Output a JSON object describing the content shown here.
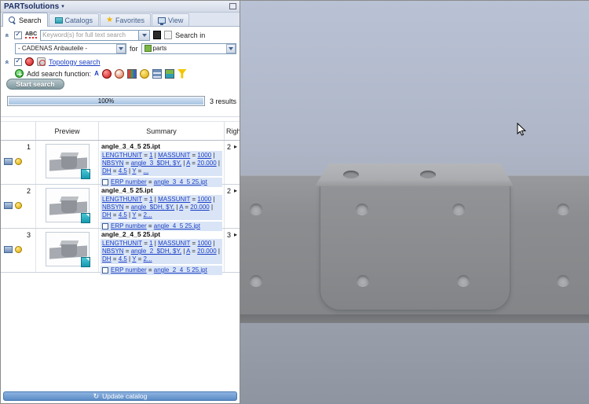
{
  "window": {
    "title": "PARTsolutions"
  },
  "icons": {
    "caret": "▾",
    "check": "✓",
    "star": "★",
    "refresh": "↻",
    "chevrons": "«",
    "expand": "▸",
    "fx_text": "A"
  },
  "tabs": {
    "search": "Search",
    "catalogs": "Catalogs",
    "favorites": "Favorites",
    "view": "View"
  },
  "search": {
    "abc": "ABC",
    "keyword_placeholder": "Keyword(s) for full text search",
    "search_in": "Search in",
    "catalog_value": "- CADENAS Anbauteile -",
    "for_label": "for",
    "scope_value": "parts",
    "topology_link": "Topology search",
    "add_function": "Add search function:",
    "start_button": "Start search"
  },
  "progress": {
    "percent": "100%",
    "results": "3 results"
  },
  "results": {
    "headers": {
      "preview": "Preview",
      "summary": "Summary",
      "right": "Right"
    },
    "rows": [
      {
        "index": "1",
        "title": "angle_3_4_5 25.ipt",
        "params": "LENGTHUNIT = 1 | MASSUNIT = 1000 | NBSYN = angle_3_$DH, $Y, | A = 20.000 | DH = 4.5 | Y = ...",
        "erp": "ERP number = angle_3_4_5 25.ipt",
        "right": "2"
      },
      {
        "index": "2",
        "title": "angle_4_5 25.ipt",
        "params": "LENGTHUNIT = 1 | MASSUNIT = 1000 | NBSYN = angle_$DH, $Y, | A = 20.000 | DH = 4.5 | Y = 2...",
        "erp": "ERP number = angle_4_5 25.ipt",
        "right": "2"
      },
      {
        "index": "3",
        "title": "angle_2_4_5 25.ipt",
        "params": "LENGTHUNIT = 1 | MASSUNIT = 1000 | NBSYN = angle_2_$DH, $Y, | A = 20.000 | DH = 4.5 | Y = 2...",
        "erp": "ERP number = angle_2_4_5 25.ipt",
        "right": "3"
      }
    ]
  },
  "footer": {
    "update_button": "Update catalog"
  }
}
